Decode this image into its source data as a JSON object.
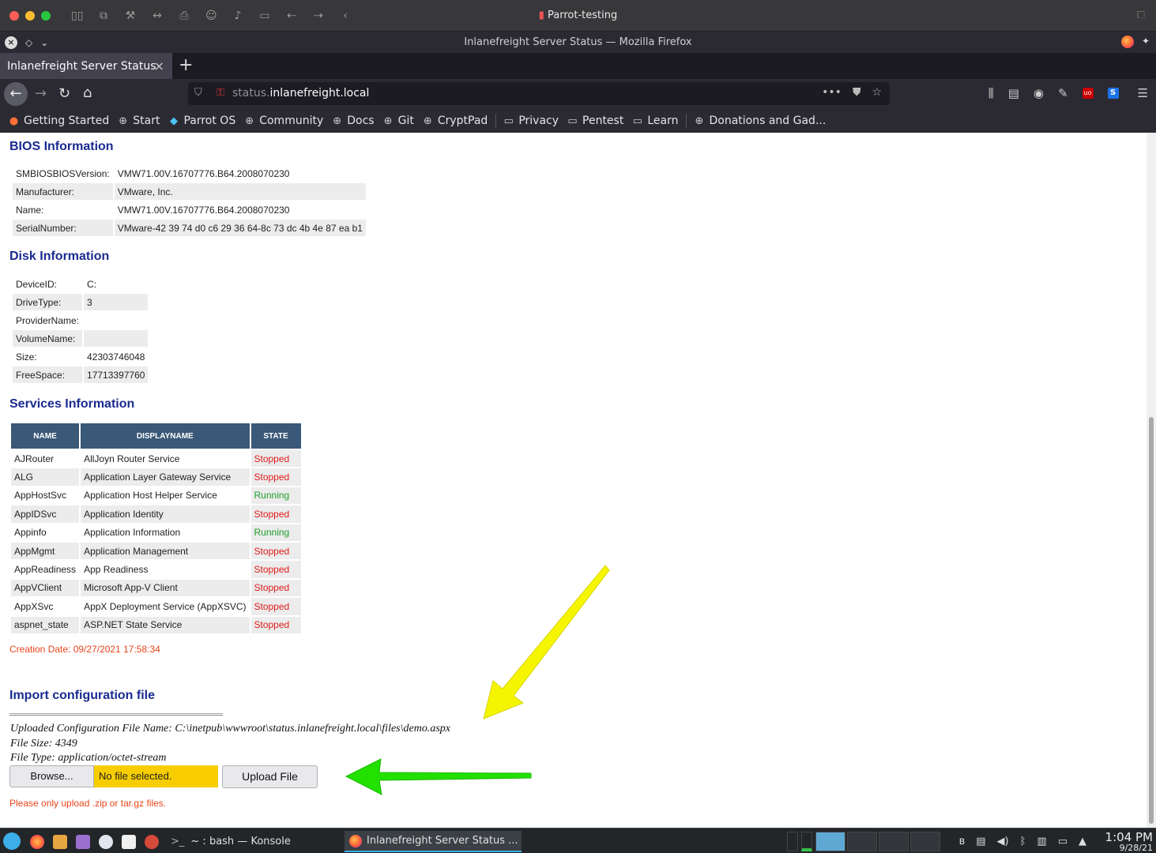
{
  "os_window": {
    "title": "Parrot-testing"
  },
  "browser": {
    "window_title": "Inlanefreight Server Status — Mozilla Firefox",
    "tab_title": "Inlanefreight Server Status",
    "url_prefix": "status.",
    "url_domain": "inlanefreight.local",
    "bookmarks": [
      {
        "label": "Getting Started",
        "icon": "firefox-icon"
      },
      {
        "label": "Start",
        "icon": "globe-icon"
      },
      {
        "label": "Parrot OS",
        "icon": "parrot-icon"
      },
      {
        "label": "Community",
        "icon": "globe-icon"
      },
      {
        "label": "Docs",
        "icon": "globe-icon"
      },
      {
        "label": "Git",
        "icon": "globe-icon"
      },
      {
        "label": "CryptPad",
        "icon": "globe-icon"
      },
      {
        "label": "Privacy",
        "icon": "folder-icon"
      },
      {
        "label": "Pentest",
        "icon": "folder-icon"
      },
      {
        "label": "Learn",
        "icon": "folder-icon"
      },
      {
        "label": "Donations and Gad...",
        "icon": "globe-icon"
      }
    ]
  },
  "page": {
    "bios": {
      "title": "BIOS Information",
      "rows": [
        {
          "key": "SMBIOSBIOSVersion:",
          "value": "VMW71.00V.16707776.B64.2008070230"
        },
        {
          "key": "Manufacturer:",
          "value": "VMware, Inc."
        },
        {
          "key": "Name:",
          "value": "VMW71.00V.16707776.B64.2008070230"
        },
        {
          "key": "SerialNumber:",
          "value": "VMware-42 39 74 d0 c6 29 36 64-8c 73 dc 4b 4e 87 ea b1"
        }
      ]
    },
    "disk": {
      "title": "Disk Information",
      "rows": [
        {
          "key": "DeviceID:",
          "value": "C:"
        },
        {
          "key": "DriveType:",
          "value": "3"
        },
        {
          "key": "ProviderName:",
          "value": ""
        },
        {
          "key": "VolumeName:",
          "value": ""
        },
        {
          "key": "Size:",
          "value": "42303746048"
        },
        {
          "key": "FreeSpace:",
          "value": "17713397760"
        }
      ]
    },
    "services": {
      "title": "Services Information",
      "headers": [
        "NAME",
        "DISPLAYNAME",
        "STATE"
      ],
      "rows": [
        {
          "name": "AJRouter",
          "display": "AllJoyn Router Service",
          "state": "Stopped"
        },
        {
          "name": "ALG",
          "display": "Application Layer Gateway Service",
          "state": "Stopped"
        },
        {
          "name": "AppHostSvc",
          "display": "Application Host Helper Service",
          "state": "Running"
        },
        {
          "name": "AppIDSvc",
          "display": "Application Identity",
          "state": "Stopped"
        },
        {
          "name": "Appinfo",
          "display": "Application Information",
          "state": "Running"
        },
        {
          "name": "AppMgmt",
          "display": "Application Management",
          "state": "Stopped"
        },
        {
          "name": "AppReadiness",
          "display": "App Readiness",
          "state": "Stopped"
        },
        {
          "name": "AppVClient",
          "display": "Microsoft App-V Client",
          "state": "Stopped"
        },
        {
          "name": "AppXSvc",
          "display": "AppX Deployment Service (AppXSVC)",
          "state": "Stopped"
        },
        {
          "name": "aspnet_state",
          "display": "ASP.NET State Service",
          "state": "Stopped"
        }
      ]
    },
    "creation_date": "Creation Date: 09/27/2021 17:58:34",
    "import": {
      "title": "Import configuration file",
      "uploaded_name": "Uploaded Configuration File Name: C:\\inetpub\\wwwroot\\status.inlanefreight.local\\files\\demo.aspx",
      "file_size": "File Size: 4349",
      "file_type": "File Type: application/octet-stream",
      "browse_label": "Browse...",
      "no_file_label": "No file selected.",
      "upload_label": "Upload File",
      "note": "Please only upload .zip or tar.gz files."
    }
  },
  "taskbar": {
    "tasks": [
      {
        "label": "~ : bash — Konsole"
      },
      {
        "label": "Inlanefreight Server Status ..."
      }
    ],
    "time": "1:04 PM",
    "date": "9/28/21"
  },
  "colors": {
    "heading": "#1a2b8f",
    "stopped": "#e01b1b",
    "running": "#1d9e2a",
    "note": "#e8451b",
    "highlight": "#f7cd00",
    "arrow_yellow": "#f5f500",
    "arrow_green": "#22e000"
  }
}
